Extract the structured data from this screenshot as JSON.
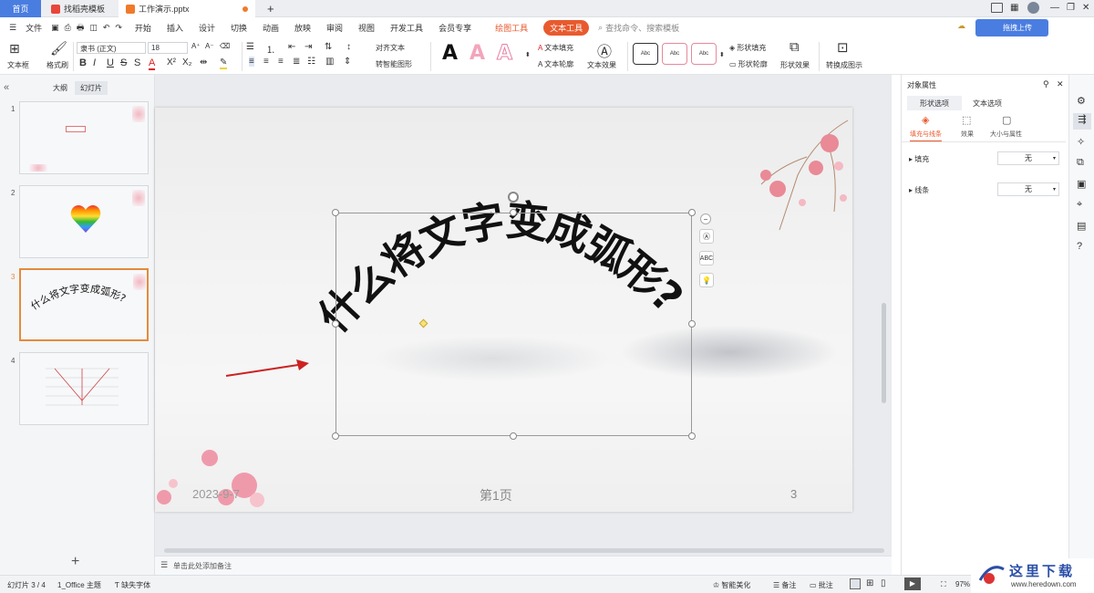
{
  "tabs": {
    "home": "首页",
    "template": "找稻壳模板",
    "document": "工作演示.pptx",
    "new_tab": "+"
  },
  "window_controls": {
    "minimize": "—",
    "restore": "❐",
    "close": "✕"
  },
  "menu": {
    "file": "文件",
    "items": [
      "开始",
      "插入",
      "设计",
      "切换",
      "动画",
      "放映",
      "审阅",
      "视图",
      "开发工具",
      "会员专享"
    ],
    "drawing_tools": "绘图工具",
    "text_tools": "文本工具",
    "search_placeholder": "查找命令、搜索模板",
    "upload": "拖拽上传"
  },
  "ribbon": {
    "textbox": "文本框",
    "format_painter": "格式刷",
    "font_name": "隶书 (正文)",
    "font_size": "18",
    "bold": "B",
    "italic": "I",
    "underline": "U",
    "strike": "S",
    "align_text": "对齐文本",
    "smart_shape": "转智能图形",
    "text_fill": "文本填充",
    "text_outline": "文本轮廓",
    "text_effect": "文本效果",
    "shape_fill": "形状填充",
    "shape_outline": "形状轮廓",
    "shape_effect": "形状效果",
    "convert_diagram": "转换成图示",
    "style_sample": "Abc",
    "big_a": "A"
  },
  "left_panel": {
    "outline_tab": "大纲",
    "slides_tab": "幻灯片",
    "add": "+",
    "collapse": "«",
    "slide_numbers": [
      "1",
      "2",
      "3",
      "4"
    ],
    "selected_slide": 3
  },
  "slide": {
    "arc_text": "什么将文字变成弧形?",
    "footer_date": "2023-9-7",
    "footer_page": "第1页",
    "footer_num": "3"
  },
  "notes": {
    "placeholder": "单击此处添加备注"
  },
  "right_panel": {
    "title": "对象属性",
    "tabs": [
      "形状选项",
      "文本选项"
    ],
    "subtabs": [
      "填充与线条",
      "效果",
      "大小与属性"
    ],
    "fill_label": "填充",
    "fill_value": "无",
    "line_label": "线条",
    "line_value": "无"
  },
  "status": {
    "slide_count": "幻灯片 3 / 4",
    "theme": "1_Office 主题",
    "missing_font": "缺失字体",
    "beautify": "智能美化",
    "notes": "备注",
    "comments": "批注",
    "zoom": "97%"
  },
  "watermark": {
    "brand": "这里下载",
    "url": "www.heredown.com"
  },
  "colors": {
    "accent": "#e85a2e",
    "tab_blue": "#4a7de0",
    "selection_border": "#e58a3c",
    "arrow_red": "#cc2222"
  }
}
